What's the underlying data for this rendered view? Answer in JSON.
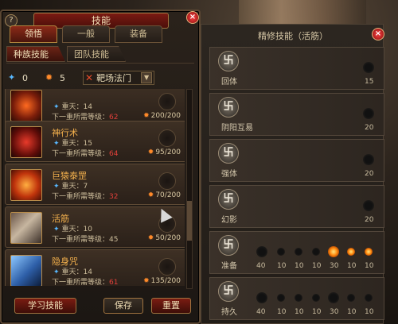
{
  "left_panel": {
    "title": "技能",
    "help": "?",
    "tabs": [
      "领悟",
      "一般",
      "装备"
    ],
    "subtabs": [
      "种族技能",
      "团队技能"
    ],
    "stats": {
      "blue_value": "0",
      "orange_value": "5"
    },
    "map_select": {
      "label": "靶场法门"
    },
    "skills": [
      {
        "name": "",
        "layer": "重天：14",
        "next_prefix": "下一重所需等级：",
        "next_level": "62",
        "exp": "200/200"
      },
      {
        "name": "神行术",
        "layer": "重天：15",
        "next_prefix": "下一重所需等级：",
        "next_level": "64",
        "exp": "95/200"
      },
      {
        "name": "巨猿泰罡",
        "layer": "重天：7",
        "next_prefix": "下一重所需等级：",
        "next_level": "32",
        "exp": "70/200"
      },
      {
        "name": "活筋",
        "layer": "重天：10",
        "next_prefix": "下一重所需等级：",
        "next_level": "45",
        "exp": "50/200"
      },
      {
        "name": "隐身咒",
        "layer": "重天：14",
        "next_prefix": "下一重所需等级：",
        "next_level": "61",
        "exp": "135/200"
      }
    ],
    "buttons": {
      "learn": "学习技能",
      "save": "保存",
      "reset": "重置"
    }
  },
  "right_panel": {
    "title": "精修技能（活筋）",
    "rows": [
      {
        "name": "回体",
        "values": [
          "15"
        ]
      },
      {
        "name": "阴阳互易",
        "values": [
          "20"
        ]
      },
      {
        "name": "强体",
        "values": [
          "20"
        ]
      },
      {
        "name": "幻影",
        "values": [
          "20"
        ]
      },
      {
        "name": "准备",
        "values": [
          "40",
          "10",
          "10",
          "10",
          "30",
          "10",
          "10"
        ]
      },
      {
        "name": "持久",
        "values": [
          "40",
          "10",
          "10",
          "10",
          "30",
          "10",
          "10"
        ]
      }
    ]
  },
  "colors": {
    "accent_red": "#7a1c12",
    "gold": "#f4b14d",
    "blue": "#58b8ff",
    "orange": "#ff8a2a"
  }
}
